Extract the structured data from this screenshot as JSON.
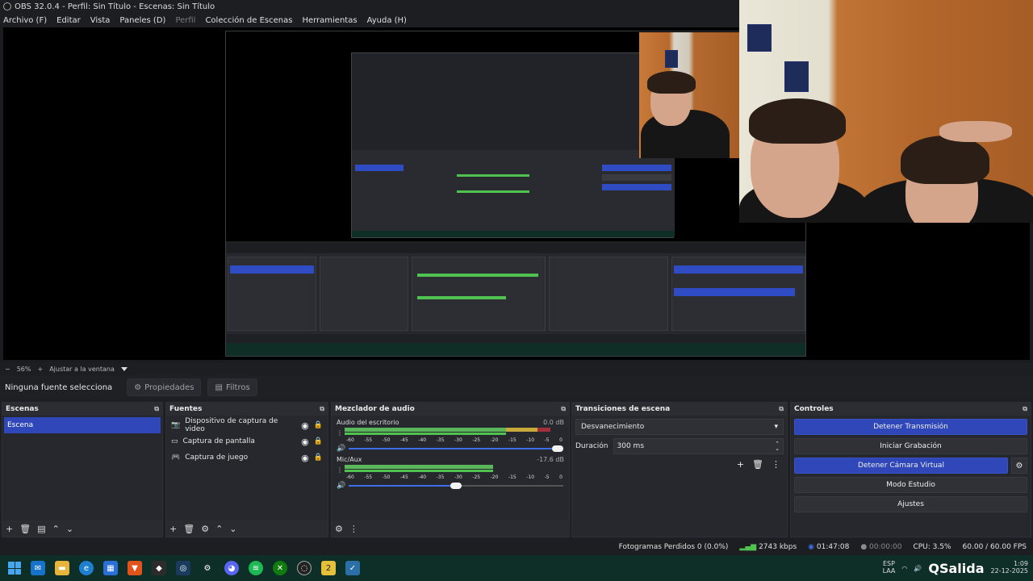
{
  "window": {
    "title": "OBS 32.0.4 - Perfil: Sin Título - Escenas: Sin Título"
  },
  "menu": {
    "items": [
      {
        "label": "Archivo (F)",
        "disabled": false
      },
      {
        "label": "Editar",
        "disabled": false
      },
      {
        "label": "Vista",
        "disabled": false
      },
      {
        "label": "Paneles (D)",
        "disabled": false
      },
      {
        "label": "Perfil",
        "disabled": true
      },
      {
        "label": "Colección de Escenas",
        "disabled": false
      },
      {
        "label": "Herramientas",
        "disabled": false
      },
      {
        "label": "Ayuda (H)",
        "disabled": false
      }
    ]
  },
  "zoom": {
    "minus": "−",
    "value": "56%",
    "plus": "+",
    "fit_label": "Ajustar a la ventana"
  },
  "source_bar": {
    "no_source": "Ninguna fuente selecciona",
    "properties": "Propiedades",
    "filters": "Filtros"
  },
  "scenes": {
    "title": "Escenas",
    "items": [
      "Escena"
    ]
  },
  "sources": {
    "title": "Fuentes",
    "items": [
      {
        "icon": "camera-icon",
        "label": "Dispositivo de captura de video"
      },
      {
        "icon": "monitor-icon",
        "label": "Captura de pantalla"
      },
      {
        "icon": "gamepad-icon",
        "label": "Captura de juego"
      }
    ]
  },
  "mixer": {
    "title": "Mezclador de audio",
    "ticks": [
      "-60",
      "-55",
      "-50",
      "-45",
      "-40",
      "-35",
      "-30",
      "-25",
      "-20",
      "-15",
      "-10",
      "-5",
      "0"
    ],
    "channels": [
      {
        "name": "Audio del escritorio",
        "db": "0.0 dB",
        "level": 0.96,
        "volume": 1.0
      },
      {
        "name": "Mic/Aux",
        "db": "-17.6 dB",
        "level": 0.69,
        "volume": 0.5
      }
    ]
  },
  "transitions": {
    "title": "Transiciones de escena",
    "selected": "Desvanecimiento",
    "duration_label": "Duración",
    "duration_value": "300 ms"
  },
  "controls": {
    "title": "Controles",
    "stream": "Detener Transmisión",
    "record": "Iniciar Grabación",
    "virtualcam": "Detener Cámara Virtual",
    "studio": "Modo Estudio",
    "settings": "Ajustes"
  },
  "status": {
    "dropped": "Fotogramas Perdidos 0 (0.0%)",
    "bitrate": "2743 kbps",
    "stream_time": "01:47:08",
    "record_time": "00:00:00",
    "cpu": "CPU: 3.5%",
    "fps": "60.00 / 60.00 FPS"
  },
  "taskbar": {
    "lang": "ESP",
    "region": "LAA",
    "brand": "Salida",
    "time": "1:09",
    "date": "22-12-2025"
  },
  "colors": {
    "accent": "#2f47b8",
    "meter_green": "#5ab75a",
    "meter_yellow": "#c8a93b",
    "meter_red": "#a0313a",
    "taskbar": "#0e2f27"
  }
}
